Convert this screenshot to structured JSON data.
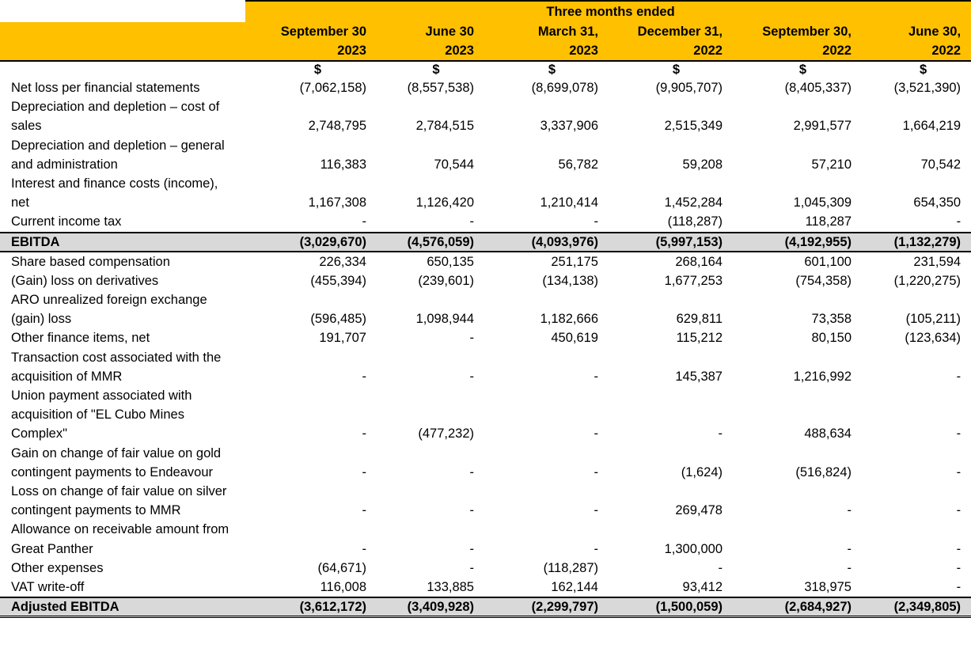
{
  "header": {
    "group_label": "Three months ended",
    "columns": [
      {
        "line1": "September 30",
        "line2": "2023"
      },
      {
        "line1": "June 30",
        "line2": "2023"
      },
      {
        "line1": "March 31,",
        "line2": "2023"
      },
      {
        "line1": "December 31,",
        "line2": "2022"
      },
      {
        "line1": "September 30,",
        "line2": "2022"
      },
      {
        "line1": "June 30,",
        "line2": "2022"
      }
    ],
    "currency": [
      "$",
      "$",
      "$",
      "$",
      "$",
      "$"
    ]
  },
  "rows": [
    {
      "label": "Net loss per financial statements",
      "values": [
        "(7,062,158)",
        "(8,557,538)",
        "(8,699,078)",
        "(9,905,707)",
        "(8,405,337)",
        "(3,521,390)"
      ]
    },
    {
      "label": "Depreciation and depletion – cost of sales",
      "values": [
        "2,748,795",
        "2,784,515",
        "3,337,906",
        "2,515,349",
        "2,991,577",
        "1,664,219"
      ]
    },
    {
      "label": "Depreciation and depletion – general and administration",
      "values": [
        "116,383",
        "70,544",
        "56,782",
        "59,208",
        "57,210",
        "70,542"
      ]
    },
    {
      "label": "Interest and finance costs (income), net",
      "values": [
        "1,167,308",
        "1,126,420",
        "1,210,414",
        "1,452,284",
        "1,045,309",
        "654,350"
      ]
    },
    {
      "label": "Current income tax",
      "values": [
        "-",
        "-",
        "-",
        "(118,287)",
        "118,287",
        "-"
      ]
    }
  ],
  "ebitda": {
    "label": "EBITDA",
    "values": [
      "(3,029,670)",
      "(4,576,059)",
      "(4,093,976)",
      "(5,997,153)",
      "(4,192,955)",
      "(1,132,279)"
    ]
  },
  "adjustments": [
    {
      "label": "Share based compensation",
      "values": [
        "226,334",
        "650,135",
        "251,175",
        "268,164",
        "601,100",
        "231,594"
      ]
    },
    {
      "label": "(Gain) loss on derivatives",
      "values": [
        "(455,394)",
        "(239,601)",
        "(134,138)",
        "1,677,253",
        "(754,358)",
        "(1,220,275)"
      ]
    },
    {
      "label": "ARO unrealized foreign exchange (gain) loss",
      "values": [
        "(596,485)",
        "1,098,944",
        "1,182,666",
        "629,811",
        "73,358",
        "(105,211)"
      ]
    },
    {
      "label": "Other finance items, net",
      "values": [
        "191,707",
        "-",
        "450,619",
        "115,212",
        "80,150",
        "(123,634)"
      ]
    },
    {
      "label": "Transaction cost associated with the acquisition of MMR",
      "values": [
        "-",
        "-",
        "-",
        "145,387",
        "1,216,992",
        "-"
      ]
    },
    {
      "label": "Union payment associated with acquisition of \"EL Cubo Mines Complex\"",
      "values": [
        "-",
        "(477,232)",
        "-",
        "-",
        "488,634",
        "-"
      ]
    },
    {
      "label": "Gain on change of fair value on gold contingent payments to Endeavour",
      "values": [
        "-",
        "-",
        "-",
        "(1,624)",
        "(516,824)",
        "-"
      ]
    },
    {
      "label": "Loss on change of fair value on silver contingent payments to MMR",
      "values": [
        "-",
        "-",
        "-",
        "269,478",
        "-",
        "-"
      ]
    },
    {
      "label": "Allowance on receivable amount from Great Panther",
      "values": [
        "-",
        "-",
        "-",
        "1,300,000",
        "-",
        "-"
      ]
    },
    {
      "label": "Other expenses",
      "values": [
        "(64,671)",
        "-",
        "(118,287)",
        "-",
        "-",
        "-"
      ]
    },
    {
      "label": "VAT write-off",
      "values": [
        "116,008",
        "133,885",
        "162,144",
        "93,412",
        "318,975",
        "-"
      ]
    }
  ],
  "adjusted_ebitda": {
    "label": "Adjusted EBITDA",
    "values": [
      "(3,612,172)",
      "(3,409,928)",
      "(2,299,797)",
      "(1,500,059)",
      "(2,684,927)",
      "(2,349,805)"
    ]
  },
  "colors": {
    "header_bg": "#ffc000",
    "total_bg": "#d9d9d9"
  }
}
